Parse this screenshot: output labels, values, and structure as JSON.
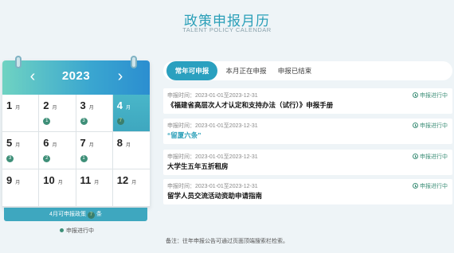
{
  "page": {
    "title": "政策申报月历",
    "subtitle": "TALENT POLICY CALENDAR"
  },
  "calendar": {
    "year": "2023",
    "prev_icon": "chevron-left-icon",
    "next_icon": "chevron-right-icon",
    "months": [
      {
        "num": "1",
        "unit": "月",
        "count": ""
      },
      {
        "num": "2",
        "unit": "月",
        "count": "1"
      },
      {
        "num": "3",
        "unit": "月",
        "count": "3"
      },
      {
        "num": "4",
        "unit": "月",
        "count": "7"
      },
      {
        "num": "5",
        "unit": "月",
        "count": "3"
      },
      {
        "num": "6",
        "unit": "月",
        "count": "2"
      },
      {
        "num": "7",
        "unit": "月",
        "count": "1"
      },
      {
        "num": "8",
        "unit": "月",
        "count": ""
      },
      {
        "num": "9",
        "unit": "月",
        "count": ""
      },
      {
        "num": "10",
        "unit": "月",
        "count": ""
      },
      {
        "num": "11",
        "unit": "月",
        "count": ""
      },
      {
        "num": "12",
        "unit": "月",
        "count": ""
      }
    ],
    "active_month_index": 3,
    "footer_prefix": "4月可申报政策",
    "footer_count": "7",
    "footer_suffix": "条",
    "legend": "申报进行中"
  },
  "tabs": [
    {
      "label": "常年可申报",
      "active": true
    },
    {
      "label": "本月正在申报",
      "active": false
    },
    {
      "label": "申报已结束",
      "active": false
    }
  ],
  "items": [
    {
      "time": "申报时间：2023-01-01至2023-12-31",
      "title": "《福建省高层次人才认定和支持办法（试行）》申报手册",
      "status": "申报进行中",
      "link": false
    },
    {
      "time": "申报时间：2023-01-01至2023-12-31",
      "title": "“留厦六条”",
      "status": "申报进行中",
      "link": true
    },
    {
      "time": "申报时间：2023-01-01至2023-12-31",
      "title": "大学生五年五折租房",
      "status": "申报进行中",
      "link": false
    },
    {
      "time": "申报时间：2023-01-01至2023-12-31",
      "title": "留学人员交流活动资助申请指南",
      "status": "申报进行中",
      "link": false
    }
  ],
  "note": "备注：往年申报公告可通过页面顶端搜索栏检索。",
  "colors": {
    "accent": "#2aa0bf",
    "status_green": "#3e8f78",
    "active_month": "#3ea7bf"
  }
}
